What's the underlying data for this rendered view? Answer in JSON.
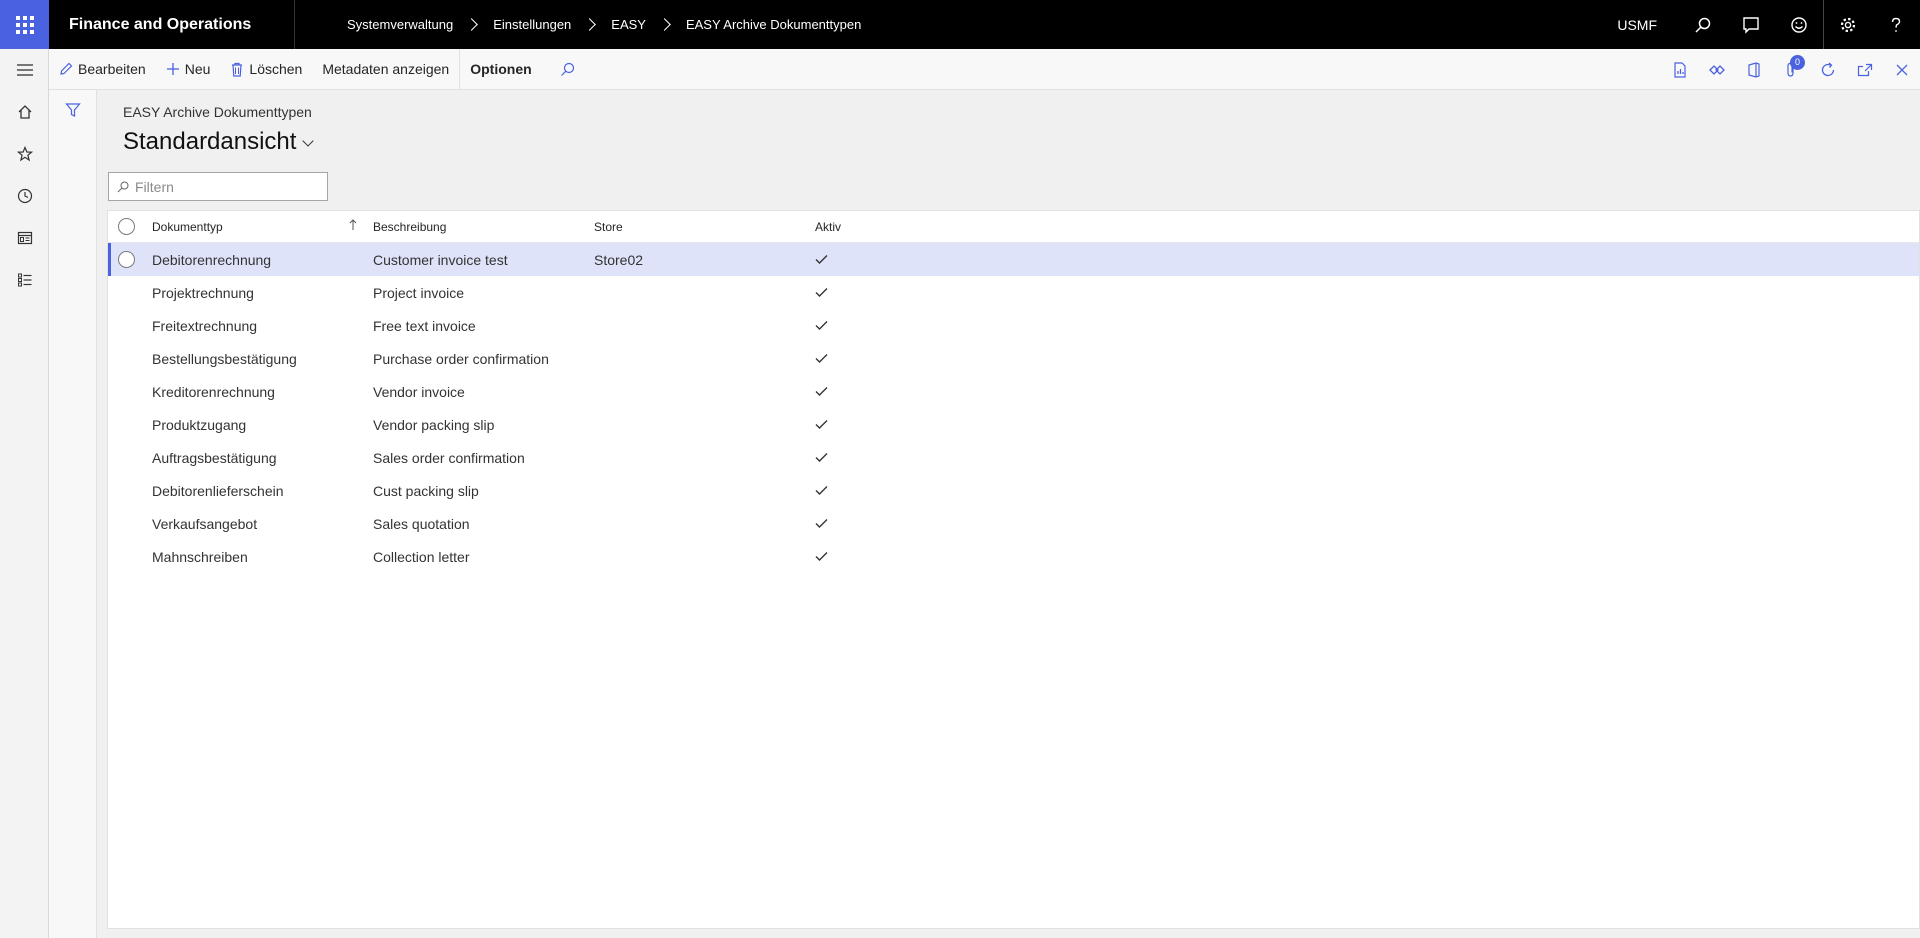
{
  "topbar": {
    "app_title": "Finance and Operations",
    "breadcrumb": [
      "Systemverwaltung",
      "Einstellungen",
      "EASY",
      "EASY Archive Dokumenttypen"
    ],
    "company": "USMF"
  },
  "actionpane": {
    "edit_label": "Bearbeiten",
    "new_label": "Neu",
    "delete_label": "Löschen",
    "metadata_label": "Metadaten anzeigen",
    "options_label": "Optionen",
    "attachments_count": "0"
  },
  "page": {
    "caption": "EASY Archive Dokumenttypen",
    "view_name": "Standardansicht",
    "filter_placeholder": "Filtern"
  },
  "grid": {
    "columns": [
      "Dokumenttyp",
      "Beschreibung",
      "Store",
      "Aktiv"
    ],
    "rows": [
      {
        "type": "Debitorenrechnung",
        "desc": "Customer invoice test",
        "store": "Store02",
        "active": true,
        "selected": true
      },
      {
        "type": "Projektrechnung",
        "desc": "Project invoice",
        "store": "",
        "active": true
      },
      {
        "type": "Freitextrechnung",
        "desc": "Free text invoice",
        "store": "",
        "active": true
      },
      {
        "type": "Bestellungsbestätigung",
        "desc": "Purchase order confirmation",
        "store": "",
        "active": true
      },
      {
        "type": "Kreditorenrechnung",
        "desc": "Vendor invoice",
        "store": "",
        "active": true
      },
      {
        "type": "Produktzugang",
        "desc": "Vendor packing slip",
        "store": "",
        "active": true
      },
      {
        "type": "Auftragsbestätigung",
        "desc": "Sales order confirmation",
        "store": "",
        "active": true
      },
      {
        "type": "Debitorenlieferschein",
        "desc": "Cust packing slip",
        "store": "",
        "active": true
      },
      {
        "type": "Verkaufsangebot",
        "desc": "Sales quotation",
        "store": "",
        "active": true
      },
      {
        "type": "Mahnschreiben",
        "desc": "Collection letter",
        "store": "",
        "active": true
      }
    ]
  },
  "colors": {
    "accent": "#4a61e0",
    "selected_row": "#dfe3fa",
    "topbar": "#000000"
  }
}
